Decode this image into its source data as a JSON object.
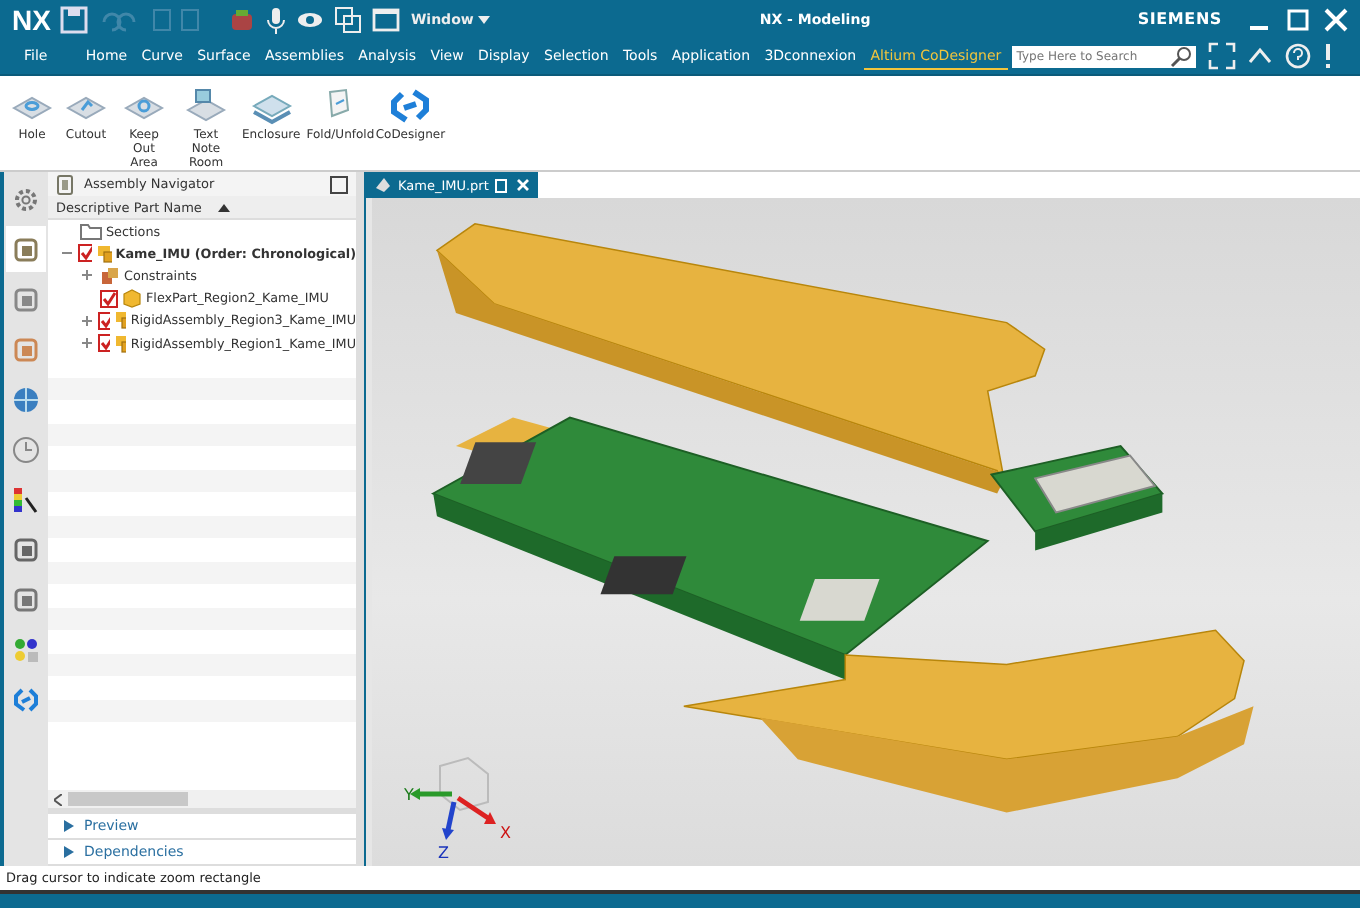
{
  "window": {
    "logo": "NX",
    "quick_access_label": "Window",
    "title": "NX - Modeling",
    "brand": "SIEMENS"
  },
  "menu": [
    {
      "label": "File",
      "selected": false
    },
    {
      "label": "Home",
      "selected": false
    },
    {
      "label": "Curve",
      "selected": false
    },
    {
      "label": "Surface",
      "selected": false
    },
    {
      "label": "Assemblies",
      "selected": false
    },
    {
      "label": "Analysis",
      "selected": false
    },
    {
      "label": "View",
      "selected": false
    },
    {
      "label": "Display",
      "selected": false
    },
    {
      "label": "Selection",
      "selected": false
    },
    {
      "label": "Tools",
      "selected": false
    },
    {
      "label": "Application",
      "selected": false
    },
    {
      "label": "3Dconnexion",
      "selected": false
    },
    {
      "label": "Altium CoDesigner",
      "selected": true
    }
  ],
  "search": {
    "placeholder": "Type Here to Search"
  },
  "ribbon": [
    {
      "label": "Hole",
      "kind": "hole"
    },
    {
      "label": "Cutout",
      "kind": "cutout"
    },
    {
      "label": "Keep Out Area",
      "kind": "keepout"
    },
    {
      "label": "Text Note Room",
      "kind": "textnote"
    },
    {
      "label": "Enclosure",
      "kind": "enclosure"
    },
    {
      "label": "Fold/Unfold",
      "kind": "fold"
    },
    {
      "label": "CoDesigner",
      "kind": "codesigner"
    }
  ],
  "resource_bar": [
    {
      "kind": "settings",
      "selected": false
    },
    {
      "kind": "assembly",
      "selected": true
    },
    {
      "kind": "part",
      "selected": false
    },
    {
      "kind": "constraint",
      "selected": false
    },
    {
      "kind": "globe",
      "selected": false
    },
    {
      "kind": "history",
      "selected": false
    },
    {
      "kind": "color",
      "selected": false
    },
    {
      "kind": "tools",
      "selected": false
    },
    {
      "kind": "role",
      "selected": false
    },
    {
      "kind": "palette",
      "selected": false
    },
    {
      "kind": "codesigner",
      "selected": false
    }
  ],
  "navigator": {
    "title": "Assembly Navigator",
    "column": "Descriptive Part Name",
    "tree": [
      {
        "label": "Sections",
        "kind": "folder"
      },
      {
        "label": "Kame_IMU (Order: Chronological)",
        "kind": "assembly",
        "checked": true,
        "expanded": true,
        "children": [
          {
            "label": "Constraints",
            "kind": "constraints",
            "expanded": false
          },
          {
            "label": "FlexPart_Region2_Kame_IMU",
            "kind": "part",
            "checked": true
          },
          {
            "label": "RigidAssembly_Region3_Kame_IMU",
            "kind": "assembly",
            "checked": true,
            "expanded": false
          },
          {
            "label": "RigidAssembly_Region1_Kame_IMU",
            "kind": "assembly",
            "checked": true,
            "expanded": false
          }
        ]
      }
    ],
    "panels": [
      {
        "label": "Preview",
        "expanded": false
      },
      {
        "label": "Dependencies",
        "expanded": false
      }
    ]
  },
  "document_tab": {
    "label": "Kame_IMU.prt",
    "selected": true
  },
  "triad": {
    "x": "X",
    "y": "Y",
    "z": "Z"
  },
  "status_bar": "Drag cursor to indicate zoom rectangle"
}
